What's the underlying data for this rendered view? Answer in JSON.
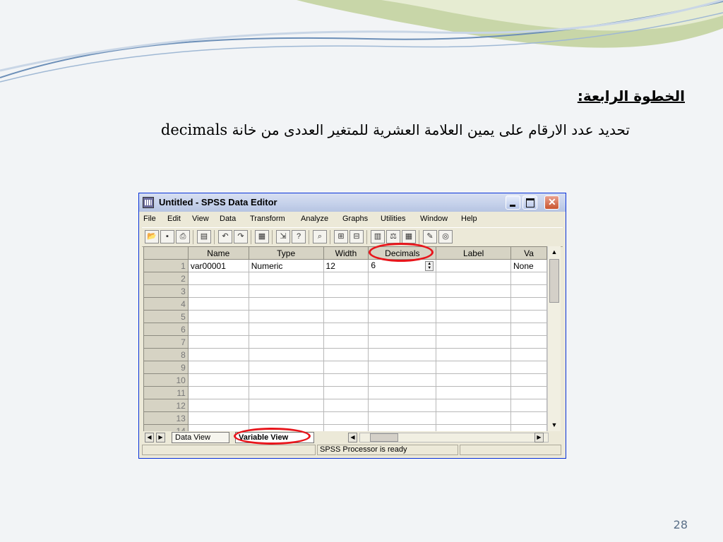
{
  "slide": {
    "heading": "الخطوة الرابعة:",
    "description_ar": "تحديد عدد الارقام على يمين العلامة العشرية للمتغير العددى من خانة",
    "description_en": "decimals",
    "page_number": "28"
  },
  "window": {
    "title": "Untitled - SPSS Data Editor",
    "menu": [
      "File",
      "Edit",
      "View",
      "Data",
      "Transform",
      "Analyze",
      "Graphs",
      "Utilities",
      "Window",
      "Help"
    ]
  },
  "grid": {
    "columns": [
      "Name",
      "Type",
      "Width",
      "Decimals",
      "Label",
      "Va"
    ],
    "row_numbers": [
      "1",
      "2",
      "3",
      "4",
      "5",
      "6",
      "7",
      "8",
      "9",
      "10",
      "11",
      "12",
      "13",
      "14"
    ],
    "row1": {
      "name": "var00001",
      "type": "Numeric",
      "width": "12",
      "decimals": "6",
      "label": "",
      "values": "None"
    }
  },
  "tabs": {
    "data_view": "Data View",
    "variable_view": "Variable View",
    "active": "Variable View"
  },
  "status": {
    "message": "SPSS Processor  is ready"
  },
  "colors": {
    "highlight_oval": "#e8151b",
    "window_frame": "#ece9d8"
  }
}
